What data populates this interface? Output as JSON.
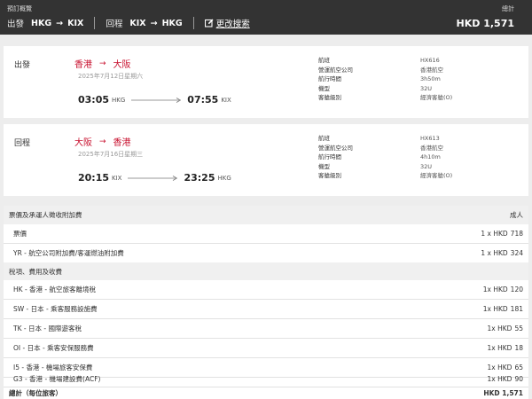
{
  "topbar": {
    "title": "預訂概覽",
    "outbound_label": "出發",
    "outbound_from": "HKG",
    "outbound_to": "KIX",
    "return_label": "回程",
    "return_from": "KIX",
    "return_to": "HKG",
    "modify_label": "更改搜索",
    "total_label": "總計",
    "total_value": "HKD 1,571"
  },
  "outbound": {
    "label": "出發",
    "from_city": "香港",
    "to_city": "大阪",
    "date": "2025年7月12日星期六",
    "dep_time": "03:05",
    "dep_code": "HKG",
    "arr_time": "07:55",
    "arr_code": "KIX",
    "details": [
      {
        "k": "航班",
        "v": "HX616"
      },
      {
        "k": "營運航空公司",
        "v": "香港航空"
      },
      {
        "k": "航行時間",
        "v": "3h50m"
      },
      {
        "k": "機型",
        "v": "32U"
      },
      {
        "k": "客艙級別",
        "v": "經濟客艙(O)"
      }
    ]
  },
  "return": {
    "label": "回程",
    "from_city": "大阪",
    "to_city": "香港",
    "date": "2025年7月16日星期三",
    "dep_time": "20:15",
    "dep_code": "KIX",
    "arr_time": "23:25",
    "arr_code": "HKG",
    "details": [
      {
        "k": "航班",
        "v": "HX613"
      },
      {
        "k": "營運航空公司",
        "v": "香港航空"
      },
      {
        "k": "航行時間",
        "v": "4h10m"
      },
      {
        "k": "機型",
        "v": "32U"
      },
      {
        "k": "客艙級別",
        "v": "經濟客艙(O)"
      }
    ]
  },
  "fares": {
    "section1_title": "票價及承運人徵收附加費",
    "section1_right": "成人",
    "fare_label": "票價",
    "fare_qty": "1 x HKD",
    "fare_amt": "718",
    "yr_label": "YR - 航空公司附加費/客運燃油附加費",
    "yr_qty": "1 x HKD",
    "yr_amt": "324",
    "section2_title": "稅項、費用及收費",
    "taxes": [
      {
        "label": "HK - 香港 - 航空旅客離境稅",
        "qty": "1x HKD",
        "amt": "120"
      },
      {
        "label": "SW - 日本 - 乘客服務設施費",
        "qty": "1x HKD",
        "amt": "181"
      },
      {
        "label": "TK - 日本 - 國際遊客稅",
        "qty": "1x HKD",
        "amt": "55"
      },
      {
        "label": "OI - 日本 - 乘客安保服務費",
        "qty": "1x HKD",
        "amt": "18"
      },
      {
        "label": "I5 - 香港 - 機場旅客安保費",
        "qty": "1x HKD",
        "amt": "65"
      },
      {
        "label": "G3 - 香港 - 機場建設費(ACF)",
        "qty": "1x HKD",
        "amt": "90"
      }
    ],
    "total_label": "總計（每位旅客）",
    "total_value": "HKD 1,571"
  }
}
